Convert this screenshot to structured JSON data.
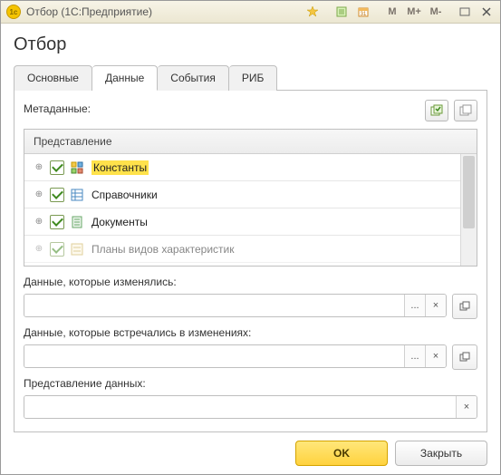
{
  "window": {
    "title": "Отбор  (1С:Предприятие)"
  },
  "page": {
    "title": "Отбор"
  },
  "tabs": [
    {
      "label": "Основные"
    },
    {
      "label": "Данные",
      "active": true
    },
    {
      "label": "События"
    },
    {
      "label": "РИБ"
    }
  ],
  "titlebar_buttons": {
    "m": "M",
    "m_plus": "M+",
    "m_minus": "M-"
  },
  "metadata": {
    "label": "Метаданные:",
    "header": "Представление",
    "rows": [
      {
        "label": "Константы",
        "checked": true,
        "highlighted": true,
        "icon": "constants"
      },
      {
        "label": "Справочники",
        "checked": true,
        "icon": "catalog"
      },
      {
        "label": "Документы",
        "checked": true,
        "icon": "document"
      },
      {
        "label": "Планы видов характеристик",
        "checked": true,
        "icon": "plan"
      }
    ]
  },
  "fields": {
    "changed": {
      "label": "Данные, которые изменялись:",
      "value": ""
    },
    "encountered": {
      "label": "Данные, которые встречались в изменениях:",
      "value": ""
    },
    "representation": {
      "label": "Представление данных:",
      "value": ""
    }
  },
  "buttons": {
    "ok": "OK",
    "close": "Закрыть",
    "ellipsis": "...",
    "clear": "×"
  }
}
